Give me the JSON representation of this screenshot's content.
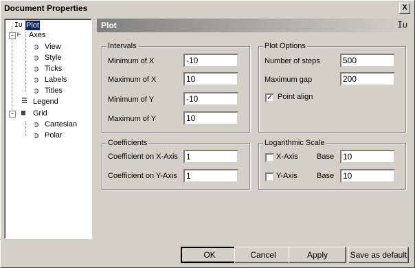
{
  "window": {
    "title": "Document Properties",
    "close_label": "X"
  },
  "tree": {
    "items": [
      {
        "label": "Plot",
        "selected": true
      },
      {
        "label": "Axes"
      },
      {
        "label": "View"
      },
      {
        "label": "Style"
      },
      {
        "label": "Ticks"
      },
      {
        "label": "Labels"
      },
      {
        "label": "Titles"
      },
      {
        "label": "Legend"
      },
      {
        "label": "Grid"
      },
      {
        "label": "Cartesian"
      },
      {
        "label": "Polar"
      }
    ]
  },
  "panel": {
    "title": "Plot"
  },
  "intervals": {
    "title": "Intervals",
    "min_x_label": "Minimum of X",
    "min_x_value": "-10",
    "max_x_label": "Maximum of X",
    "max_x_value": "10",
    "min_y_label": "Minimum of Y",
    "min_y_value": "-10",
    "max_y_label": "Maximum of Y",
    "max_y_value": "10"
  },
  "plot_options": {
    "title": "Plot Options",
    "steps_label": "Number of steps",
    "steps_value": "500",
    "gap_label": "Maximum gap",
    "gap_value": "200",
    "align_label": "Point align",
    "align_checked": true
  },
  "coefficients": {
    "title": "Coefficients",
    "x_label": "Coefficient on X-Axis",
    "x_value": "1",
    "y_label": "Coefficient on Y-Axis",
    "y_value": "1"
  },
  "log_scale": {
    "title": "Logarithmic Scale",
    "x_label": "X-Axis",
    "x_checked": false,
    "x_base_label": "Base",
    "x_base_value": "10",
    "y_label": "Y-Axis",
    "y_checked": false,
    "y_base_label": "Base",
    "y_base_value": "10"
  },
  "buttons": {
    "ok": "OK",
    "cancel": "Cancel",
    "apply": "Apply",
    "save_default": "Save as default"
  }
}
